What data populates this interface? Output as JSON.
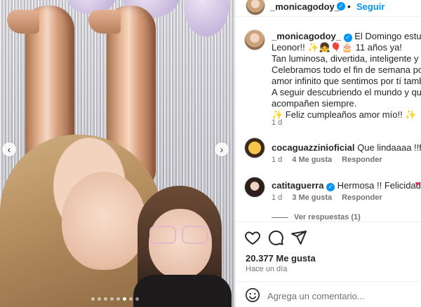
{
  "post": {
    "username": "_monicagodoy_",
    "follow_label": "Seguir",
    "caption_lines": [
      "El Domingo estuvo de",
      "Leonor!! ✨👧🎈🎂 11 años ya!",
      "Tan luminosa, divertida, inteligente y sabia",
      "Celebramos todo el fin de semana porque",
      "amor infinito que sentimos por tí también",
      "A seguir descubriendo el mundo y que las",
      "acompañen siempre.",
      "✨ Feliz cumpleaños amor mío!! ✨"
    ],
    "caption_time": "1 d",
    "likes": "20.377 Me gusta",
    "posted_ago": "Hace un día",
    "add_comment_placeholder": "Agrega un comentario..."
  },
  "comments": [
    {
      "username": "cocaguazzinioficial",
      "text": "Que lindaaaa !!feliz Cu",
      "time": "1 d",
      "likes": "4 Me gusta",
      "reply": "Responder"
    },
    {
      "username": "catitaguerra",
      "text": "Hermosa !! Felicidades !",
      "time": "1 d",
      "likes": "3 Me gusta",
      "reply": "Responder"
    }
  ],
  "view_replies": "Ver respuestas (1)",
  "icons": {
    "like": "heart-icon",
    "comment": "comment-icon",
    "share": "share-icon",
    "emoji": "emoji-icon",
    "verified": "verified-badge-icon",
    "carousel_prev": "chevron-left-icon",
    "carousel_next": "chevron-right-icon"
  },
  "carousel": {
    "total": 8,
    "active_index": 5
  },
  "colors": {
    "accent": "#0095f6",
    "heart": "#e0245e",
    "muted": "#737373"
  }
}
